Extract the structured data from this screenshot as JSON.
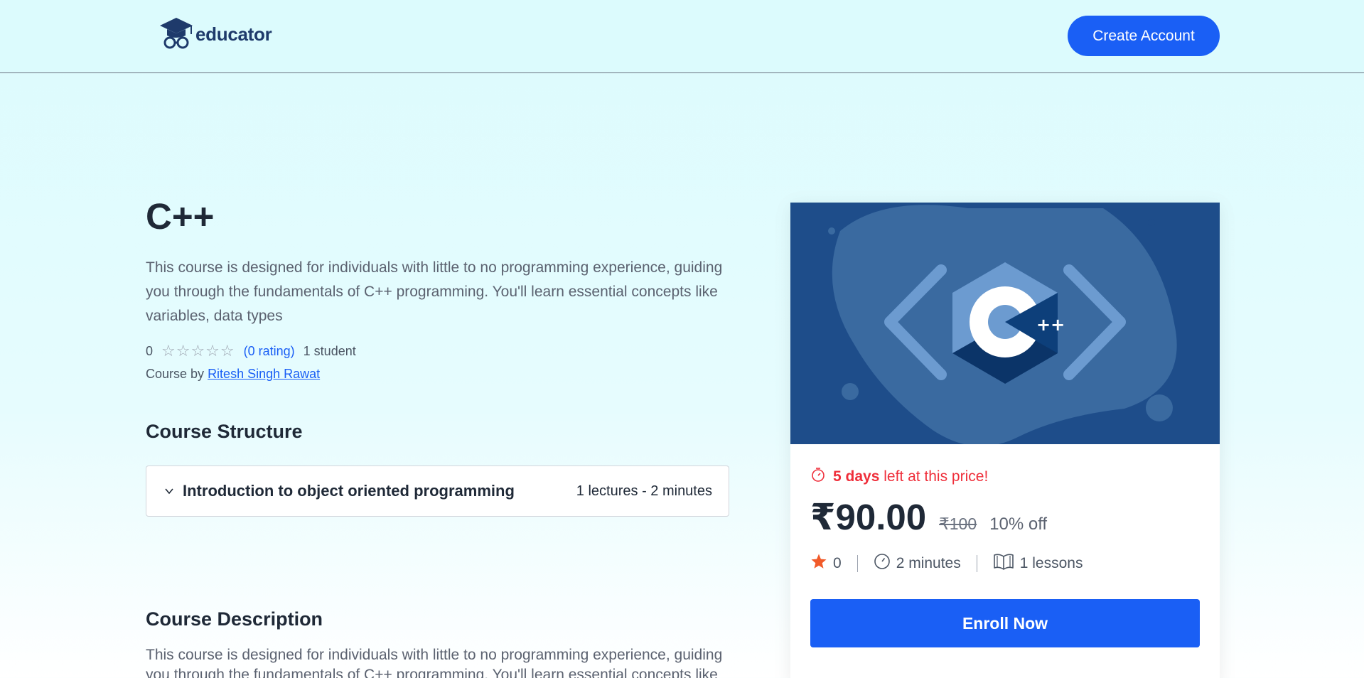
{
  "header": {
    "logo_text": "educator",
    "create_account_label": "Create Account"
  },
  "course": {
    "title": "C++",
    "summary": "This course is designed for individuals with little to no programming experience, guiding you through the fundamentals of C++ programming. You'll learn essential concepts like variables, data types",
    "rating_value": "0",
    "rating_stars": 0,
    "rating_max": 5,
    "rating_count_label": "(0 rating)",
    "students_label": "1 student",
    "course_by_label": "Course by",
    "instructor": "Ritesh Singh Rawat"
  },
  "structure": {
    "heading": "Course Structure",
    "chapters": [
      {
        "title": "Introduction to object oriented programming",
        "meta": "1 lectures - 2 minutes"
      }
    ]
  },
  "description": {
    "heading": "Course Description",
    "text": "This course is designed for individuals with little to no programming experience, guiding you through the fundamentals of C++ programming. You'll learn essential concepts like"
  },
  "card": {
    "urgency_days": "5 days",
    "urgency_rest": " left at this price!",
    "price": "₹90.00",
    "old_price": "₹100",
    "discount": "10% off",
    "rating": "0",
    "duration": "2 minutes",
    "lessons": "1 lessons",
    "enroll_label": "Enroll Now"
  },
  "colors": {
    "accent": "#1a5ff5",
    "urgency": "#ef2e3a",
    "star": "#f15a29",
    "page_bg": "#dcfbfd",
    "thumb_bg": "#1e4d8a"
  },
  "icons": {
    "logo": "graduation-cap-glasses-icon",
    "chapter_toggle": "chevron-down-icon",
    "urgency": "timer-icon",
    "rating": "star-icon",
    "duration": "clock-icon",
    "lessons": "book-open-icon"
  }
}
